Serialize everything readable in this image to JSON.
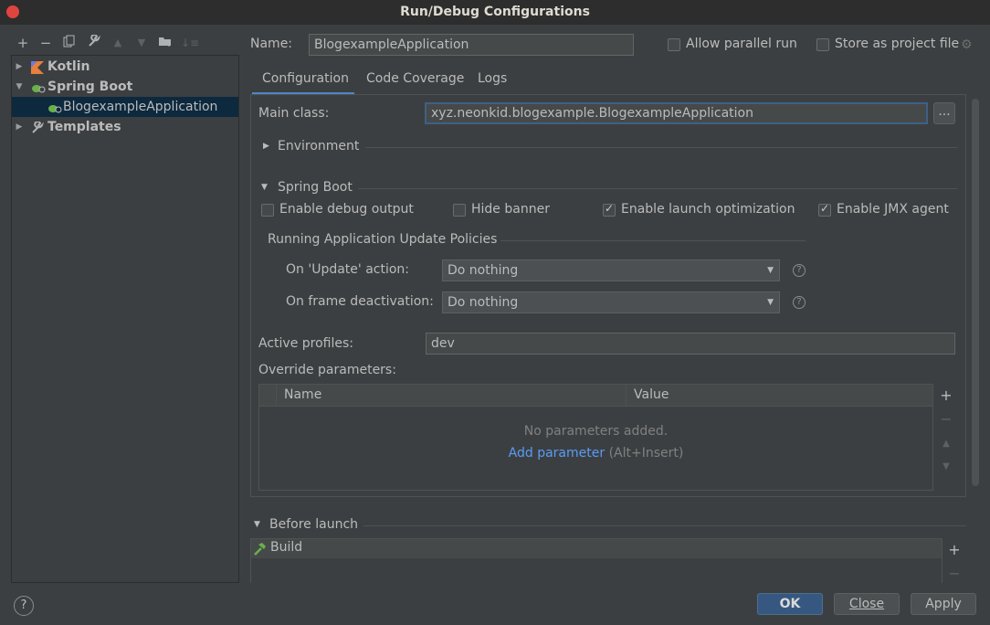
{
  "window": {
    "title": "Run/Debug Configurations"
  },
  "toolbar": {
    "icons": [
      "add-icon",
      "remove-icon",
      "copy-icon",
      "wrench-icon",
      "move-up-icon",
      "move-down-icon",
      "new-folder-icon",
      "sort-icon"
    ]
  },
  "tree": {
    "items": [
      {
        "label": "Kotlin",
        "icon": "kotlin-icon"
      },
      {
        "label": "Spring Boot",
        "icon": "spring-boot-icon"
      },
      {
        "label": "BlogexampleApplication",
        "icon": "spring-boot-app-icon"
      },
      {
        "label": "Templates",
        "icon": "wrench-icon"
      }
    ]
  },
  "form": {
    "name_label": "Name:",
    "name_value": "BlogexampleApplication",
    "allow_parallel_label": "Allow parallel run",
    "store_project_label": "Store as project file"
  },
  "tabs": [
    "Configuration",
    "Code Coverage",
    "Logs"
  ],
  "config": {
    "main_class_label": "Main class:",
    "main_class_value": "xyz.neonkid.blogexample.BlogexampleApplication",
    "browse_label": "...",
    "environment_label": "Environment",
    "spring_boot_label": "Spring Boot",
    "enable_debug_label": "Enable debug output",
    "hide_banner_label": "Hide banner",
    "launch_opt_label": "Enable launch optimization",
    "jmx_label": "Enable JMX agent",
    "policies_label": "Running Application Update Policies",
    "update_action_label": "On 'Update' action:",
    "update_action_value": "Do nothing",
    "frame_deactivation_label": "On frame deactivation:",
    "frame_deactivation_value": "Do nothing",
    "active_profiles_label": "Active profiles:",
    "active_profiles_value": "dev",
    "override_label": "Override parameters:",
    "table_headers": [
      "Name",
      "Value"
    ],
    "empty_text": "No parameters added.",
    "add_param_link": "Add parameter",
    "add_param_shortcut": "(Alt+Insert)"
  },
  "before_launch": {
    "label": "Before launch",
    "task": "Build"
  },
  "buttons": {
    "ok": "OK",
    "close": "Close",
    "apply": "Apply",
    "help": "?"
  },
  "colors": {
    "background": "#3c3f41",
    "selection": "#0d293e",
    "primary": "#365880",
    "link": "#589df6"
  }
}
